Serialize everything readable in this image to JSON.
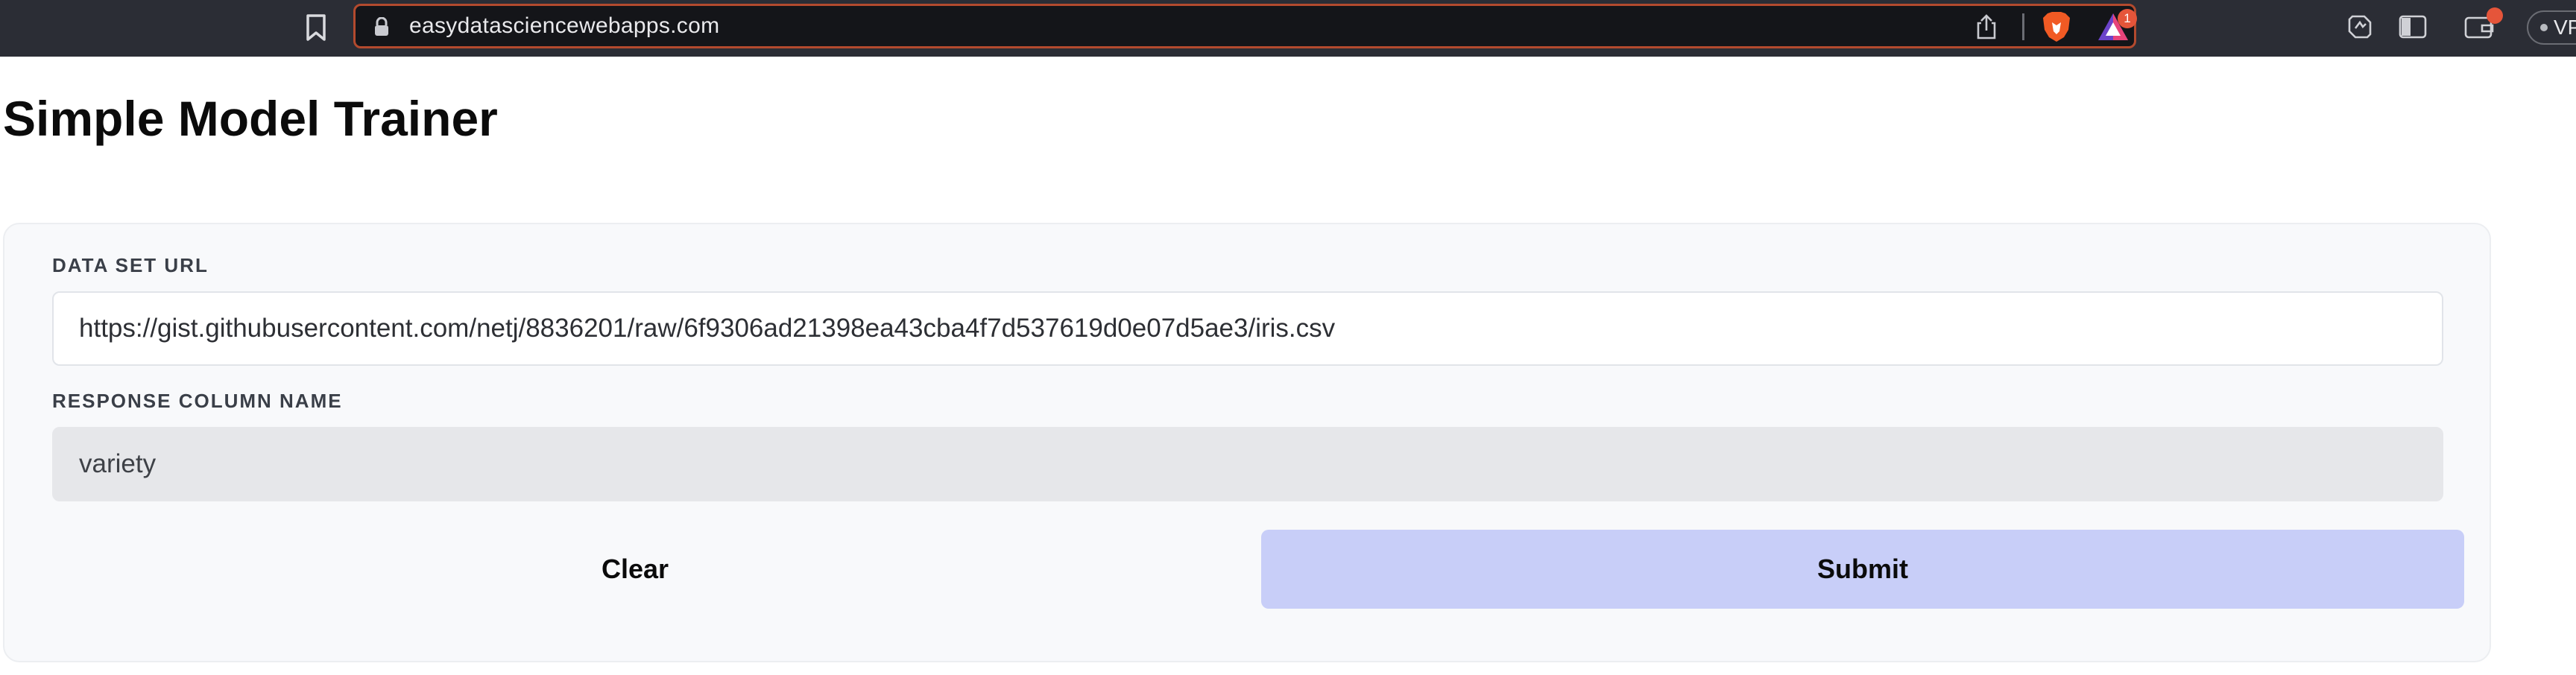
{
  "browser": {
    "url": "easydatasciencewebapps.com",
    "rewards_badge_count": "1",
    "vpn_label": "VPN",
    "icons": [
      "bookmark-icon",
      "lock-icon",
      "share-icon",
      "brave-icon",
      "rewards-icon",
      "leo-icon",
      "sidebar-icon",
      "wallet-icon"
    ],
    "accent_color": "#b34a2e"
  },
  "page": {
    "title": "Simple Model Trainer"
  },
  "form": {
    "dataset_url_label": "DATA SET URL",
    "dataset_url_value": "https://gist.githubusercontent.com/netj/8836201/raw/6f9306ad21398ea43cba4f7d537619d0e07d5ae3/iris.csv",
    "response_label": "RESPONSE COLUMN NAME",
    "response_value": "variety",
    "clear_label": "Clear",
    "submit_label": "Submit",
    "submit_color": "#c8cef8"
  }
}
